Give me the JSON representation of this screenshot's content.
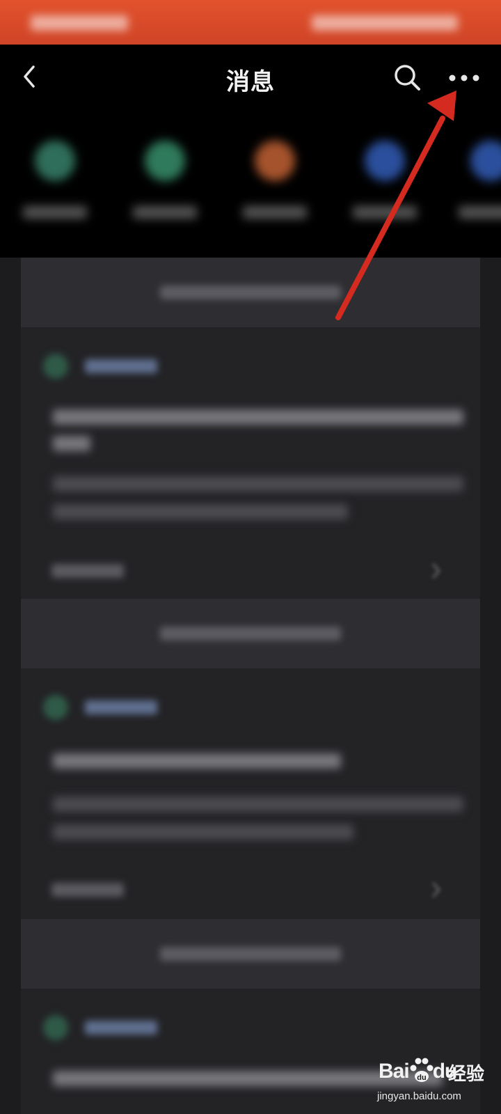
{
  "header": {
    "title": "消息",
    "back_icon": "chevron-left-icon",
    "search_icon": "search-icon",
    "more_icon": "more-dots-icon"
  },
  "quick_actions": [
    {
      "icon": "circle-icon",
      "color": "#2f6e5a"
    },
    {
      "icon": "bulb-icon",
      "color": "#2f7a5c"
    },
    {
      "icon": "box-icon",
      "color": "#a5532c"
    },
    {
      "icon": "person-icon",
      "color": "#2b4f9c"
    },
    {
      "icon": "circle-icon",
      "color": "#2b4f9c"
    }
  ],
  "colors": {
    "status_bar": "#d9472a",
    "header_bg": "#000000",
    "feed_bg": "#1c1c1e",
    "card_bg": "#232326",
    "timebar_bg": "#2e2e32",
    "annotation_arrow": "#d42a1f"
  },
  "watermark": {
    "brand": "Bai",
    "brand_suffix": "du",
    "jingyan": "经验",
    "url": "jingyan.baidu.com"
  }
}
